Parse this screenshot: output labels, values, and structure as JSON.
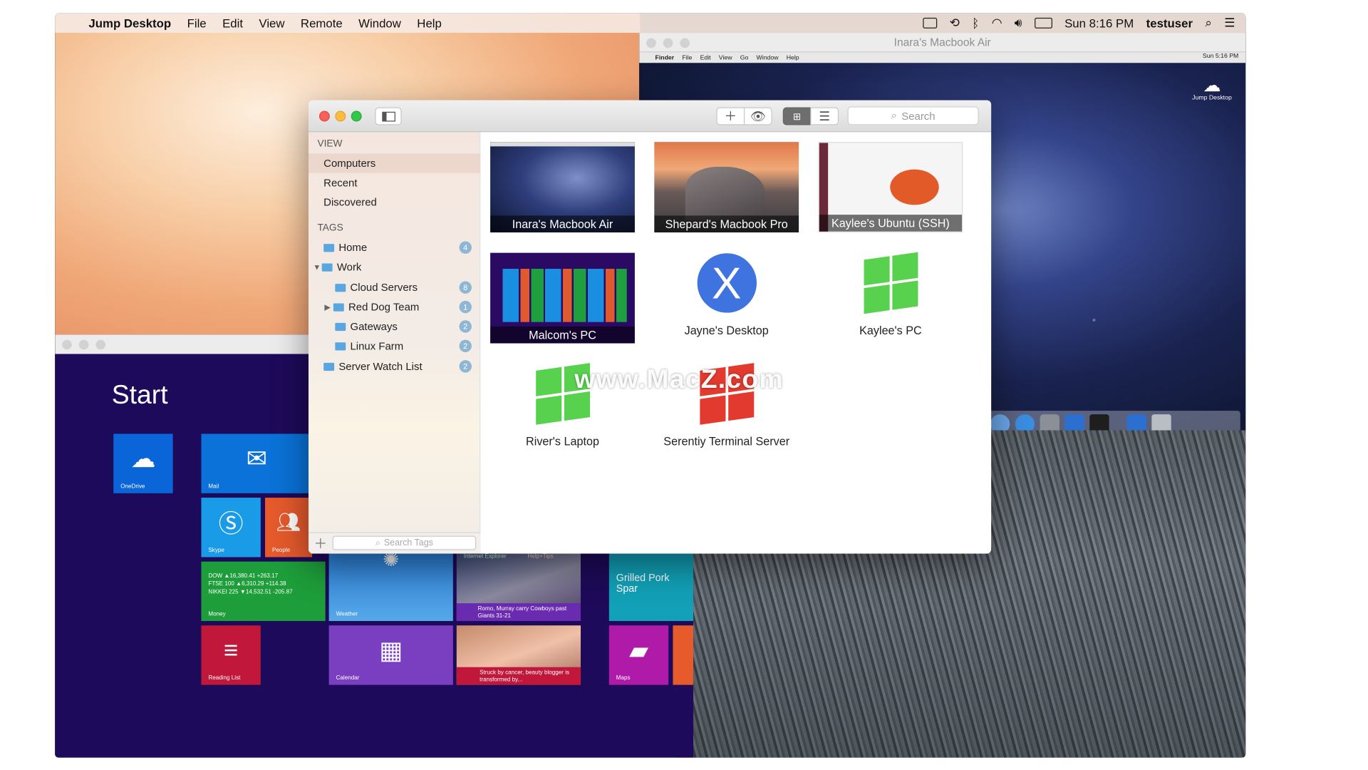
{
  "menubar": {
    "app_name": "Jump Desktop",
    "items": [
      "File",
      "Edit",
      "View",
      "Remote",
      "Window",
      "Help"
    ],
    "clock": "Sun 8:16 PM",
    "user": "testuser"
  },
  "mac_remote": {
    "title": "Inara's Macbook Air",
    "menu": [
      "Finder",
      "File",
      "Edit",
      "View",
      "Go",
      "Window",
      "Help"
    ],
    "clock": "Sun 5:16 PM",
    "logo_label": "Jump Desktop"
  },
  "win_remote": {
    "start_label": "Start",
    "tiles": {
      "onedrive": "OneDrive",
      "mail": "Mail",
      "skype": "Skype",
      "people": "People",
      "money": "Money",
      "money_lines": [
        "DOW  ▲16,380.41 +263.17",
        "FTSE 100  ▲6,310.29 +114.38",
        "NIKKEI 225  ▼14,532.51 -205.87"
      ],
      "weather": "Weather",
      "ie": "Internet Explorer",
      "help": "Help+Tips",
      "news": "Romo, Murray carry Cowboys past Giants 31-21",
      "food": "Grilled Pork Spar",
      "reading": "Reading List",
      "calendar": "Calendar",
      "health": "Struck by cancer, beauty blogger is transformed by...",
      "maps": "Maps"
    }
  },
  "jump": {
    "search_placeholder": "Search",
    "tag_search_placeholder": "Search Tags",
    "view_header": "VIEW",
    "tags_header": "TAGS",
    "view_items": [
      "Computers",
      "Recent",
      "Discovered"
    ],
    "tags": [
      {
        "label": "Home",
        "count": "4"
      },
      {
        "label": "Work",
        "count": ""
      },
      {
        "label": "Cloud Servers",
        "count": "8"
      },
      {
        "label": "Red Dog Team",
        "count": "1"
      },
      {
        "label": "Gateways",
        "count": "2"
      },
      {
        "label": "Linux Farm",
        "count": "2"
      },
      {
        "label": "Server Watch List",
        "count": "2"
      }
    ],
    "computers": [
      "Inara's Macbook Air",
      "Shepard's Macbook Pro",
      "Kaylee's Ubuntu (SSH)",
      "Malcom's PC",
      "Jayne's Desktop",
      "Kaylee's PC",
      "River's Laptop",
      "Serentiy Terminal Server"
    ],
    "watermark": "www.MacZ.com"
  },
  "colors": {
    "accent": "#4a7de8",
    "win_blue": "#0a66d8",
    "win_green": "#58d24e",
    "win_red": "#e23a2e"
  }
}
